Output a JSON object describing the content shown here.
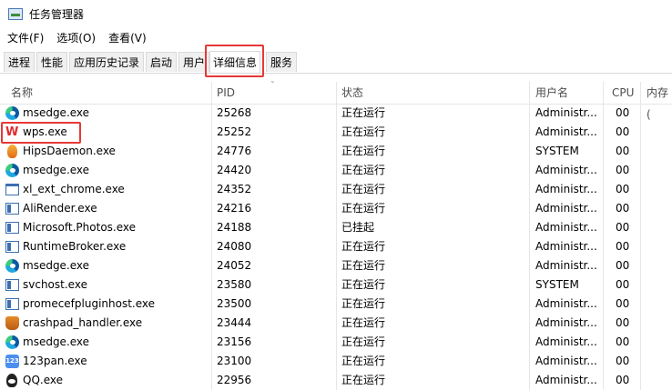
{
  "window": {
    "title": "任务管理器"
  },
  "menu": [
    "文件(F)",
    "选项(O)",
    "查看(V)"
  ],
  "tabs": [
    "进程",
    "性能",
    "应用历史记录",
    "启动",
    "用户",
    "详细信息",
    "服务"
  ],
  "active_tab": "详细信息",
  "columns": [
    "名称",
    "PID",
    "状态",
    "用户名",
    "CPU",
    "内存("
  ],
  "rows": [
    {
      "name": "msedge.exe",
      "pid": "25268",
      "status": "正在运行",
      "user": "Administr...",
      "cpu": "00",
      "icon": "edge-icon"
    },
    {
      "name": "wps.exe",
      "pid": "25252",
      "status": "正在运行",
      "user": "Administr...",
      "cpu": "00",
      "icon": "wps-icon"
    },
    {
      "name": "HipsDaemon.exe",
      "pid": "24776",
      "status": "正在运行",
      "user": "SYSTEM",
      "cpu": "00",
      "icon": "flame-icon"
    },
    {
      "name": "msedge.exe",
      "pid": "24420",
      "status": "正在运行",
      "user": "Administr...",
      "cpu": "00",
      "icon": "edge-icon"
    },
    {
      "name": "xl_ext_chrome.exe",
      "pid": "24352",
      "status": "正在运行",
      "user": "Administr...",
      "cpu": "00",
      "icon": "window-icon"
    },
    {
      "name": "AliRender.exe",
      "pid": "24216",
      "status": "正在运行",
      "user": "Administr...",
      "cpu": "00",
      "icon": "app-window-icon"
    },
    {
      "name": "Microsoft.Photos.exe",
      "pid": "24188",
      "status": "已挂起",
      "user": "Administr...",
      "cpu": "00",
      "icon": "app-window-icon"
    },
    {
      "name": "RuntimeBroker.exe",
      "pid": "24080",
      "status": "正在运行",
      "user": "Administr...",
      "cpu": "00",
      "icon": "app-window-icon"
    },
    {
      "name": "msedge.exe",
      "pid": "24052",
      "status": "正在运行",
      "user": "Administr...",
      "cpu": "00",
      "icon": "edge-icon"
    },
    {
      "name": "svchost.exe",
      "pid": "23580",
      "status": "正在运行",
      "user": "SYSTEM",
      "cpu": "00",
      "icon": "app-window-icon"
    },
    {
      "name": "promecefpluginhost.exe",
      "pid": "23500",
      "status": "正在运行",
      "user": "Administr...",
      "cpu": "00",
      "icon": "app-window-icon"
    },
    {
      "name": "crashpad_handler.exe",
      "pid": "23444",
      "status": "正在运行",
      "user": "Administr...",
      "cpu": "00",
      "icon": "crashpad-icon"
    },
    {
      "name": "msedge.exe",
      "pid": "23156",
      "status": "正在运行",
      "user": "Administr...",
      "cpu": "00",
      "icon": "edge-icon"
    },
    {
      "name": "123pan.exe",
      "pid": "23100",
      "status": "正在运行",
      "user": "Administr...",
      "cpu": "00",
      "icon": "pan-icon"
    },
    {
      "name": "QQ.exe",
      "pid": "22956",
      "status": "正在运行",
      "user": "Administr...",
      "cpu": "00",
      "icon": "qq-icon"
    }
  ],
  "colors": {
    "highlight": "#e53935",
    "edge_blue": "#0c59a4",
    "wps_red": "#e02d2d"
  }
}
